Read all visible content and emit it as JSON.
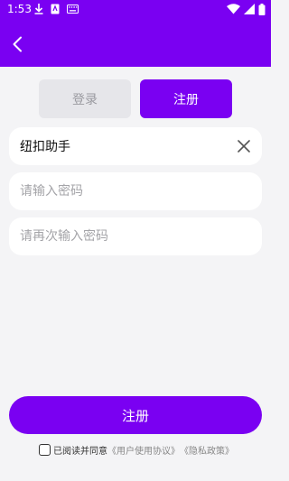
{
  "status_bar": {
    "time": "1:53"
  },
  "tabs": {
    "login": "登录",
    "register": "注册"
  },
  "form": {
    "username_value": "纽扣助手",
    "password_placeholder": "请输入密码",
    "confirm_placeholder": "请再次输入密码"
  },
  "submit_label": "注册",
  "agreement": {
    "prefix": "已阅读并同意",
    "user_agreement": "《用户使用协议》",
    "privacy_policy": "《隐私政策》"
  },
  "colors": {
    "accent": "#7a00f2",
    "background": "#f4f4f6",
    "tab_inactive": "#e6e6ea"
  },
  "icons": [
    "download-icon",
    "sim-icon",
    "keyboard-icon",
    "wifi-icon",
    "signal-icon",
    "battery-icon",
    "back-arrow-icon",
    "clear-icon"
  ]
}
